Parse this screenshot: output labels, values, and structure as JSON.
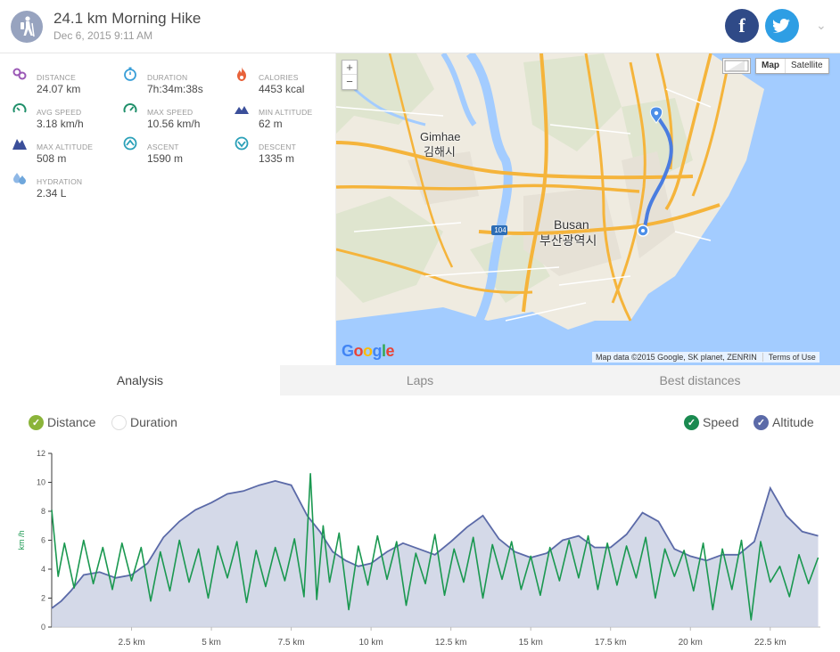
{
  "header": {
    "title": "24.1 km Morning Hike",
    "date": "Dec 6, 2015 9:11 AM",
    "facebook_glyph": "f",
    "twitter_glyph": "t",
    "menu_glyph": "⌄"
  },
  "stats": [
    {
      "label": "DISTANCE",
      "value": "24.07 km",
      "icon": "distance-icon",
      "color": "#9b59b6"
    },
    {
      "label": "DURATION",
      "value": "7h:34m:38s",
      "icon": "stopwatch-icon",
      "color": "#3a9fd8"
    },
    {
      "label": "CALORIES",
      "value": "4453 kcal",
      "icon": "flame-icon",
      "color": "#e8623a"
    },
    {
      "label": "AVG SPEED",
      "value": "3.18 km/h",
      "icon": "speedometer-icon",
      "color": "#1f8f6a"
    },
    {
      "label": "MAX SPEED",
      "value": "10.56 km/h",
      "icon": "speedometer-max-icon",
      "color": "#1f8f6a"
    },
    {
      "label": "MIN ALTITUDE",
      "value": "62 m",
      "icon": "mountain-low-icon",
      "color": "#3b4f9a"
    },
    {
      "label": "MAX ALTITUDE",
      "value": "508 m",
      "icon": "mountain-high-icon",
      "color": "#3b4f9a"
    },
    {
      "label": "ASCENT",
      "value": "1590 m",
      "icon": "ascent-icon",
      "color": "#2aa0b8"
    },
    {
      "label": "DESCENT",
      "value": "1335 m",
      "icon": "descent-icon",
      "color": "#2aa0b8"
    },
    {
      "label": "HYDRATION",
      "value": "2.34 L",
      "icon": "water-drops-icon",
      "color": "#6fa7dc"
    }
  ],
  "map": {
    "zoom_in": "+",
    "zoom_out": "−",
    "type_map": "Map",
    "type_satellite": "Satellite",
    "labels": {
      "gimhae_en": "Gimhae",
      "gimhae_ko": "김해시",
      "busan_en": "Busan",
      "busan_ko": "부산광역시",
      "road_shield": "104"
    },
    "google_logo": "Google",
    "attribution": "Map data ©2015 Google, SK planet, ZENRIN",
    "terms": "Terms of Use"
  },
  "tabs": [
    "Analysis",
    "Laps",
    "Best distances"
  ],
  "toggles": {
    "distance": "Distance",
    "duration": "Duration",
    "speed": "Speed",
    "altitude": "Altitude",
    "check_glyph": "✓"
  },
  "colors": {
    "speed": "#1a9850",
    "altitude": "#5b6aa8",
    "distance_check": "#8bb43a",
    "speed_check": "#1a8a50",
    "altitude_check": "#5b6aa8"
  },
  "chart_data": {
    "type": "line",
    "ylabel": "km /h",
    "ylim": [
      0,
      12
    ],
    "yticks": [
      "0",
      "2",
      "4",
      "6",
      "8",
      "10",
      "12"
    ],
    "xlim": [
      0,
      24.07
    ],
    "xticks": [
      "2.5 km",
      "5 km",
      "7.5 km",
      "10 km",
      "12.5 km",
      "15 km",
      "17.5 km",
      "20 km",
      "22.5 km"
    ],
    "xtick_values": [
      2.5,
      5,
      7.5,
      10,
      12.5,
      15,
      17.5,
      20,
      22.5
    ],
    "series": [
      {
        "name": "Speed",
        "x": [
          0,
          0.2,
          0.4,
          0.7,
          1.0,
          1.3,
          1.6,
          1.9,
          2.2,
          2.5,
          2.8,
          3.1,
          3.4,
          3.7,
          4.0,
          4.3,
          4.6,
          4.9,
          5.2,
          5.5,
          5.8,
          6.1,
          6.4,
          6.7,
          7.0,
          7.3,
          7.6,
          7.9,
          8.1,
          8.3,
          8.5,
          8.7,
          9.0,
          9.3,
          9.6,
          9.9,
          10.2,
          10.5,
          10.8,
          11.1,
          11.4,
          11.7,
          12.0,
          12.3,
          12.6,
          12.9,
          13.2,
          13.5,
          13.8,
          14.1,
          14.4,
          14.7,
          15.0,
          15.3,
          15.6,
          15.9,
          16.2,
          16.5,
          16.8,
          17.1,
          17.4,
          17.7,
          18.0,
          18.3,
          18.6,
          18.9,
          19.2,
          19.5,
          19.8,
          20.1,
          20.4,
          20.7,
          21.0,
          21.3,
          21.6,
          21.9,
          22.2,
          22.5,
          22.8,
          23.1,
          23.4,
          23.7,
          24.0
        ],
        "values": [
          8.1,
          3.5,
          5.8,
          2.7,
          6.0,
          3.0,
          5.5,
          2.6,
          5.8,
          3.2,
          5.5,
          1.8,
          5.2,
          2.5,
          6.0,
          3.1,
          5.4,
          2.0,
          5.6,
          3.4,
          5.9,
          1.7,
          5.3,
          2.8,
          5.5,
          3.2,
          6.1,
          2.1,
          10.6,
          1.9,
          7.0,
          3.1,
          6.5,
          1.2,
          5.6,
          2.9,
          6.3,
          3.3,
          5.9,
          1.5,
          5.1,
          3.0,
          6.4,
          2.2,
          5.4,
          3.1,
          6.2,
          2.0,
          5.7,
          3.3,
          5.9,
          2.6,
          4.9,
          2.2,
          5.5,
          3.2,
          6.0,
          3.4,
          6.3,
          2.6,
          5.8,
          2.9,
          5.6,
          3.4,
          6.2,
          2.0,
          5.4,
          3.5,
          5.3,
          2.5,
          5.8,
          1.2,
          5.4,
          2.6,
          6.0,
          0.5,
          5.9,
          3.1,
          4.2,
          2.1,
          5.0,
          3.0,
          4.8
        ]
      },
      {
        "name": "Altitude",
        "x": [
          0,
          0.3,
          0.6,
          1.0,
          1.5,
          2.0,
          2.5,
          3.0,
          3.5,
          4.0,
          4.5,
          5.0,
          5.5,
          6.0,
          6.5,
          7.0,
          7.5,
          8.0,
          8.4,
          8.8,
          9.2,
          9.6,
          10.0,
          10.5,
          11.0,
          11.5,
          12.0,
          12.5,
          13.0,
          13.5,
          14.0,
          14.5,
          15.0,
          15.5,
          16.0,
          16.5,
          17.0,
          17.5,
          18.0,
          18.5,
          19.0,
          19.5,
          20.0,
          20.5,
          21.0,
          21.5,
          22.0,
          22.5,
          23.0,
          23.5,
          24.0
        ],
        "values": [
          1.3,
          1.8,
          2.5,
          3.6,
          3.8,
          3.4,
          3.6,
          4.4,
          6.2,
          7.3,
          8.1,
          8.6,
          9.2,
          9.4,
          9.8,
          10.1,
          9.8,
          7.7,
          6.6,
          5.2,
          4.6,
          4.2,
          4.4,
          5.2,
          5.8,
          5.4,
          5.0,
          5.9,
          6.9,
          7.7,
          6.1,
          5.2,
          4.8,
          5.1,
          6.0,
          6.3,
          5.5,
          5.5,
          6.4,
          7.9,
          7.3,
          5.4,
          4.9,
          4.6,
          5.0,
          5.0,
          5.9,
          9.6,
          7.7,
          6.6,
          6.3
        ]
      }
    ]
  }
}
